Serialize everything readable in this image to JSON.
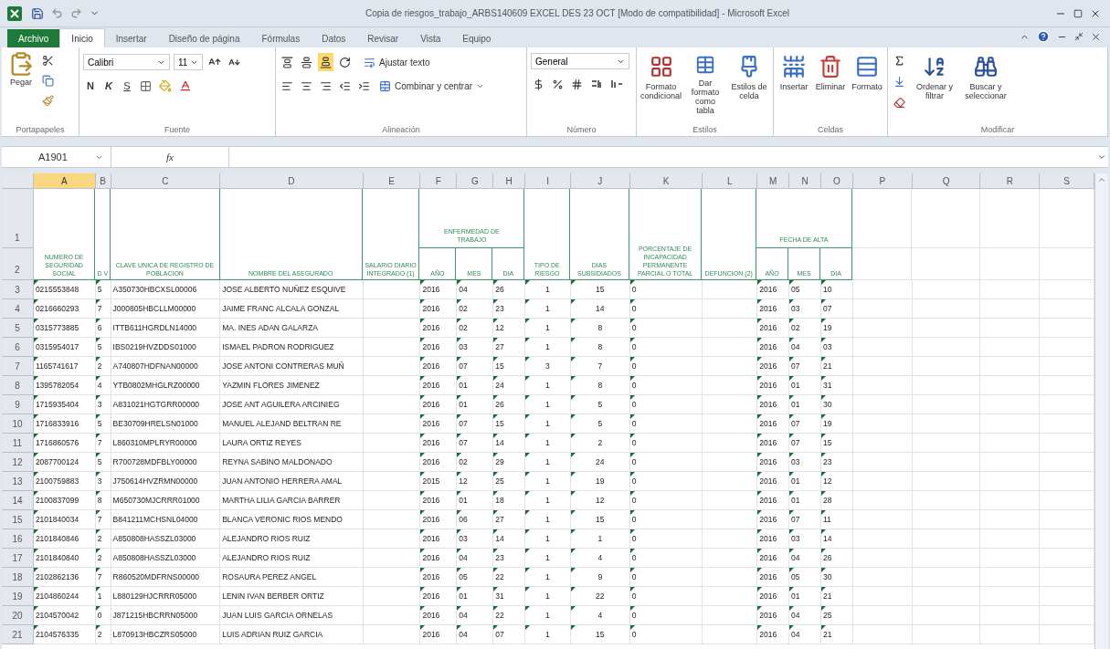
{
  "window": {
    "title": "Copia de riesgos_trabajo_ARBS140609 EXCEL DES 23 OCT [Modo de compatibilidad] - Microsoft Excel"
  },
  "tabs": [
    {
      "label": "Archivo",
      "kind": "file",
      "selected": false
    },
    {
      "label": "Inicio",
      "kind": "tab",
      "selected": true
    },
    {
      "label": "Insertar",
      "kind": "tab",
      "selected": false
    },
    {
      "label": "Diseño de página",
      "kind": "tab",
      "selected": false
    },
    {
      "label": "Fórmulas",
      "kind": "tab",
      "selected": false
    },
    {
      "label": "Datos",
      "kind": "tab",
      "selected": false
    },
    {
      "label": "Revisar",
      "kind": "tab",
      "selected": false
    },
    {
      "label": "Vista",
      "kind": "tab",
      "selected": false
    },
    {
      "label": "Equipo",
      "kind": "tab",
      "selected": false
    }
  ],
  "ribbon": {
    "clipboard": {
      "label": "Portapapeles",
      "paste": "Pegar"
    },
    "font": {
      "label": "Fuente",
      "name": "Calibri",
      "size": "11",
      "bold": "N",
      "italic": "K",
      "underline": "S"
    },
    "alignment": {
      "label": "Alineación",
      "wrap": "Ajustar texto",
      "merge": "Combinar y centrar"
    },
    "number": {
      "label": "Número",
      "format": "General"
    },
    "styles": {
      "label": "Estilos",
      "buttons": [
        "Formato condicional",
        "Dar formato como tabla",
        "Estilos de celda"
      ]
    },
    "cells": {
      "label": "Celdas",
      "buttons": [
        "Insertar",
        "Eliminar",
        "Formato"
      ]
    },
    "editing": {
      "label": "Modificar",
      "buttons": [
        "Ordenar y filtrar",
        "Buscar y seleccionar"
      ]
    }
  },
  "sheet": {
    "name_box": "A1901",
    "function_label": "fx",
    "columns": [
      {
        "letter": "A",
        "selected": true,
        "warning": true
      },
      {
        "letter": "B",
        "selected": false,
        "warning": true
      },
      {
        "letter": "C",
        "selected": false,
        "warning": false
      },
      {
        "letter": "D",
        "selected": false,
        "warning": false
      },
      {
        "letter": "E",
        "selected": false,
        "warning": false
      },
      {
        "letter": "F",
        "selected": false,
        "warning": true
      },
      {
        "letter": "G",
        "selected": false,
        "warning": true
      },
      {
        "letter": "H",
        "selected": false,
        "warning": true
      },
      {
        "letter": "I",
        "selected": false,
        "warning": true
      },
      {
        "letter": "J",
        "selected": false,
        "warning": true
      },
      {
        "letter": "K",
        "selected": false,
        "warning": true
      },
      {
        "letter": "L",
        "selected": false,
        "warning": false
      },
      {
        "letter": "M",
        "selected": false,
        "warning": true
      },
      {
        "letter": "N",
        "selected": false,
        "warning": true
      },
      {
        "letter": "O",
        "selected": false,
        "warning": true
      },
      {
        "letter": "P",
        "selected": false,
        "warning": false
      },
      {
        "letter": "Q",
        "selected": false,
        "warning": false
      },
      {
        "letter": "R",
        "selected": false,
        "warning": false
      },
      {
        "letter": "S",
        "selected": false,
        "warning": false
      }
    ],
    "header_rows": [
      "1",
      "2"
    ],
    "header": [
      {
        "kind": "single",
        "text": "NUMERO DE SEGURIDAD SOCIAL"
      },
      {
        "kind": "single",
        "text": "D V"
      },
      {
        "kind": "single",
        "text": "CLAVE UNICA DE REGISTRO DE POBLACION"
      },
      {
        "kind": "single",
        "text": "NOMBRE DEL ASEGURADO"
      },
      {
        "kind": "single",
        "text": "SALARIO DIARIO INTEGRADO (1)"
      },
      {
        "kind": "group",
        "title": "ENFERMEDAD DE TRABAJO",
        "subs": [
          "AÑO",
          "MES",
          "DIA"
        ]
      },
      {
        "kind": "single",
        "text": "TIPO DE RIESGO"
      },
      {
        "kind": "single",
        "text": "DIAS SUBSIDIADOS"
      },
      {
        "kind": "single",
        "text": "PORCENTAJE DE INCAPACIDAD PERMANENTE PARCIAL O TOTAL"
      },
      {
        "kind": "single",
        "text": "DEFUNCION (2)"
      },
      {
        "kind": "group",
        "title": "FECHA DE ALTA",
        "subs": [
          "AÑO",
          "MES",
          "DIA"
        ]
      },
      {
        "kind": "empty"
      },
      {
        "kind": "empty"
      },
      {
        "kind": "empty"
      },
      {
        "kind": "empty"
      }
    ],
    "rows": [
      {
        "row": "3",
        "values": [
          "0215553848",
          "5",
          "A350730HBCXSL00006",
          "JOSE ALBERTO NUÑEZ ESQUIVE",
          "2016",
          "04",
          "26",
          "1",
          "15",
          "0",
          "2016",
          "05",
          "10"
        ]
      },
      {
        "row": "4",
        "values": [
          "0216660293",
          "7",
          "J000805HBCLLM00000",
          "JAIME FRANC ALCALA GONZAL",
          "2016",
          "02",
          "23",
          "1",
          "14",
          "0",
          "2016",
          "03",
          "07"
        ]
      },
      {
        "row": "5",
        "values": [
          "0315773885",
          "6",
          "ITTB611HGRDLN14000",
          "MA. INES ADAN GALARZA",
          "2016",
          "02",
          "12",
          "1",
          "8",
          "0",
          "2016",
          "02",
          "19"
        ]
      },
      {
        "row": "6",
        "values": [
          "0315954017",
          "5",
          "IBS0219HVZDDS01000",
          "ISMAEL PADRON RODRIGUEZ",
          "2016",
          "03",
          "27",
          "1",
          "8",
          "0",
          "2016",
          "04",
          "03"
        ]
      },
      {
        "row": "7",
        "values": [
          "1165741617",
          "2",
          "A740807HDFNAN00000",
          "JOSE ANTONI CONTRERAS MUÑ",
          "2016",
          "07",
          "15",
          "3",
          "7",
          "0",
          "2016",
          "07",
          "21"
        ]
      },
      {
        "row": "8",
        "values": [
          "1395782054",
          "4",
          "YTB0802MHGLRZ00000",
          "YAZMIN FLORES JIMENEZ",
          "2016",
          "01",
          "24",
          "1",
          "8",
          "0",
          "2016",
          "01",
          "31"
        ]
      },
      {
        "row": "9",
        "values": [
          "1715935404",
          "3",
          "A831021HGTGRR00000",
          "JOSE ANT AGUILERA ARCINIEG",
          "2016",
          "01",
          "26",
          "1",
          "5",
          "0",
          "2016",
          "01",
          "30"
        ]
      },
      {
        "row": "10",
        "values": [
          "1716833916",
          "5",
          "BE30709HRELSN01000",
          "MANUEL ALEJAND BELTRAN RE",
          "2016",
          "07",
          "15",
          "1",
          "5",
          "0",
          "2016",
          "07",
          "19"
        ]
      },
      {
        "row": "11",
        "values": [
          "1716860576",
          "7",
          "L860310MPLRYR00000",
          "LAURA ORTIZ REYES",
          "2016",
          "07",
          "14",
          "1",
          "2",
          "0",
          "2016",
          "07",
          "15"
        ]
      },
      {
        "row": "12",
        "values": [
          "2087700124",
          "5",
          "R700728MDFBLY00000",
          "REYNA SABINO MALDONADO",
          "2016",
          "02",
          "29",
          "1",
          "24",
          "0",
          "2016",
          "03",
          "23"
        ]
      },
      {
        "row": "13",
        "values": [
          "2100759883",
          "3",
          "J750614HVZRMN00000",
          "JUAN ANTONIO HERRERA AMAL",
          "2015",
          "12",
          "25",
          "1",
          "19",
          "0",
          "2016",
          "01",
          "12"
        ]
      },
      {
        "row": "14",
        "values": [
          "2100837099",
          "8",
          "M650730MJCRRR01000",
          "MARTHA LILIA GARCIA BARRER",
          "2016",
          "01",
          "18",
          "1",
          "12",
          "0",
          "2016",
          "01",
          "28"
        ]
      },
      {
        "row": "15",
        "values": [
          "2101840034",
          "7",
          "B841211MCHSNL04000",
          "BLANCA VERONIC RIOS MENDO",
          "2016",
          "06",
          "27",
          "1",
          "15",
          "0",
          "2016",
          "07",
          "11"
        ]
      },
      {
        "row": "16",
        "values": [
          "2101840846",
          "2",
          "A850808HASSZL03000",
          "ALEJANDRO RIOS RUIZ",
          "2016",
          "03",
          "14",
          "1",
          "1",
          "0",
          "2016",
          "03",
          "14"
        ]
      },
      {
        "row": "17",
        "values": [
          "2101840840",
          "2",
          "A850808HASSZL03000",
          "ALEJANDRO RIOS RUIZ",
          "2016",
          "04",
          "23",
          "1",
          "4",
          "0",
          "2016",
          "04",
          "26"
        ]
      },
      {
        "row": "18",
        "values": [
          "2102862136",
          "7",
          "R860520MDFRNS00000",
          "ROSAURA PEREZ ANGEL",
          "2016",
          "05",
          "22",
          "1",
          "9",
          "0",
          "2016",
          "05",
          "30"
        ]
      },
      {
        "row": "19",
        "values": [
          "2104860244",
          "1",
          "L880129HJCRRR05000",
          "LENIN IVAN BERBER ORTIZ",
          "2016",
          "01",
          "31",
          "1",
          "22",
          "0",
          "2016",
          "01",
          "21"
        ]
      },
      {
        "row": "20",
        "values": [
          "2104570042",
          "0",
          "J871215HBCRRN05000",
          "JUAN LUIS GARCIA ORNELAS",
          "2016",
          "04",
          "22",
          "1",
          "4",
          "0",
          "2016",
          "04",
          "25"
        ]
      },
      {
        "row": "21",
        "values": [
          "2104576335",
          "2",
          "L870913HBCZRS05000",
          "LUIS ADRIAN RUIZ GARCIA",
          "2016",
          "04",
          "07",
          "1",
          "15",
          "0",
          "2016",
          "04",
          "21"
        ]
      }
    ]
  }
}
